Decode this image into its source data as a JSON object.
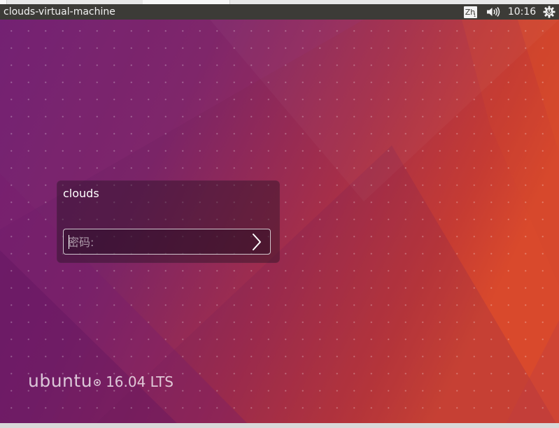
{
  "panel": {
    "hostname": "clouds-virtual-machine",
    "keyboard_indicator": "Zh",
    "clock": "10:16"
  },
  "login": {
    "username": "clouds",
    "password_placeholder": "密码:",
    "password_value": ""
  },
  "branding": {
    "word": "ubuntu",
    "version": "16.04 LTS"
  },
  "icons": {
    "keyboard": "keyboard-layout-icon",
    "volume": "volume-icon",
    "power": "power-gear-icon",
    "submit": "chevron-right-icon",
    "brand": "circle-of-friends-icon"
  },
  "colors": {
    "panel": "#3c3b37",
    "wallpaper_purple": "#6b1f6b",
    "wallpaper_orange": "#e2542b"
  }
}
